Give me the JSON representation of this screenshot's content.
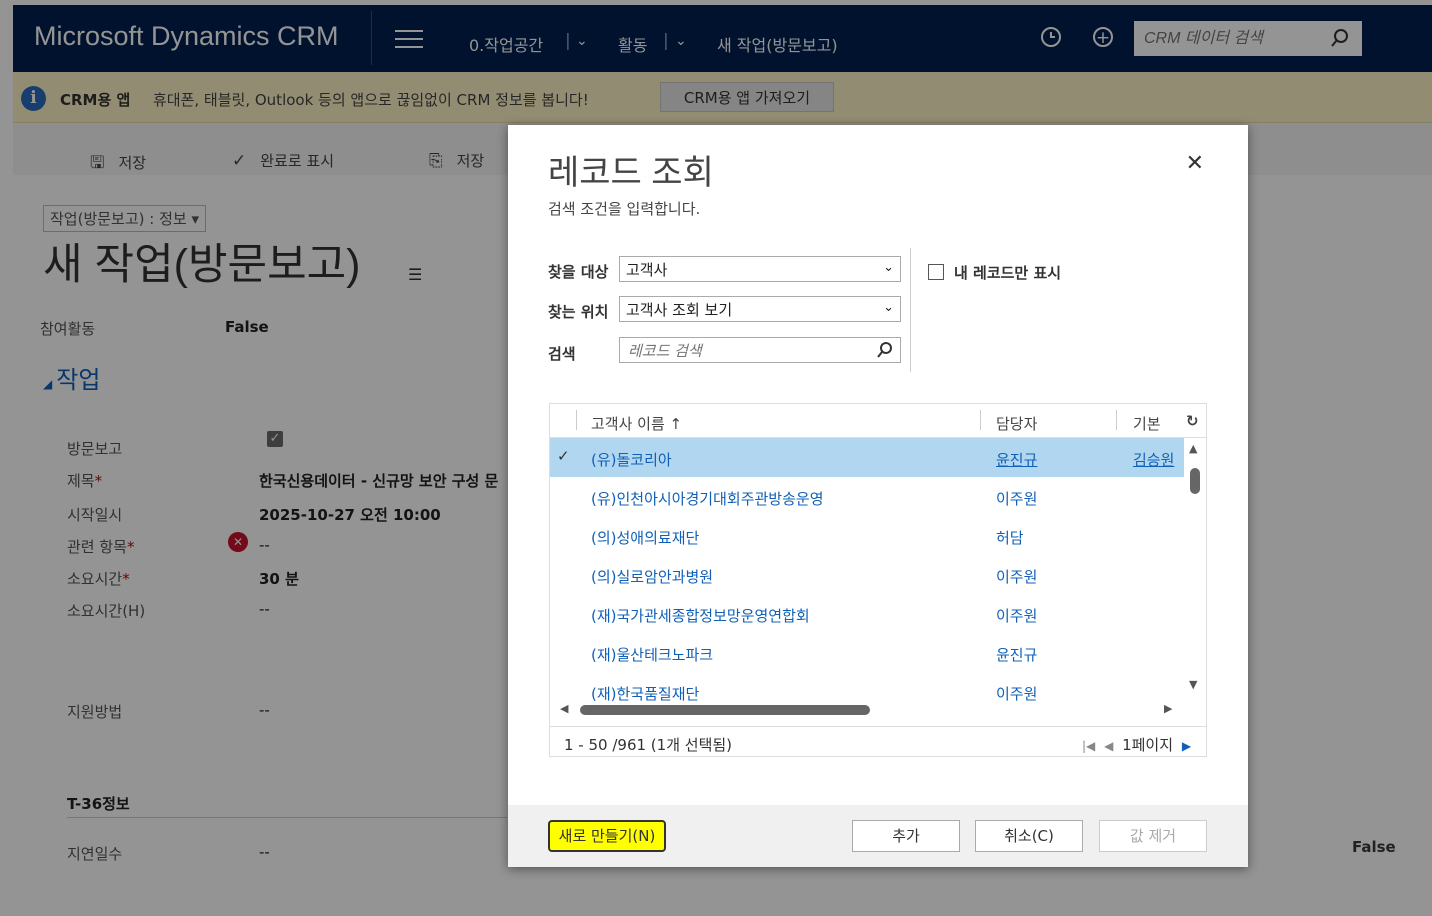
{
  "app": {
    "brand": "Microsoft Dynamics CRM"
  },
  "nav": {
    "workspace": "0.작업공간",
    "activity": "활동",
    "record": "새 작업(방문보고)",
    "search_placeholder": "CRM 데이터 검색"
  },
  "infobar": {
    "title": "CRM용 앱",
    "text": "휴대폰, 태블릿, Outlook 등의 앱으로 끊임없이 CRM 정보를 봅니다!",
    "button": "CRM용 앱 가져오기"
  },
  "commands": {
    "save": "저장",
    "mark_complete": "완료로 표시",
    "save_as": "저장"
  },
  "form": {
    "selector": "작업(방문보고) : 정보",
    "title": "새 작업(방문보고)",
    "participation_label": "참여활동",
    "participation_value": "False",
    "section": "작업",
    "fields": {
      "visit_report": "방문보고",
      "subject_label": "제목",
      "subject_value": "한국신용데이터 - 신규망 보안 구성 문",
      "start_label": "시작일시",
      "start_value": "2025-10-27  오전 10:00",
      "regarding_label": "관련 항목",
      "regarding_value": "--",
      "duration_label": "소요시간",
      "duration_value": "30 분",
      "duration_h_label": "소요시간(H)",
      "duration_h_value": "--",
      "support_label": "지원방법",
      "support_value": "--"
    },
    "section2": "T-36정보",
    "delay_label": "지연일수",
    "delay_value": "--",
    "right_false": "False"
  },
  "dialog": {
    "title": "레코드 조회",
    "subtitle": "검색 조건을 입력합니다.",
    "look_for_label": "찾을 대상",
    "look_for_value": "고객사",
    "look_in_label": "찾는 위치",
    "look_in_value": "고객사 조회 보기",
    "search_label": "검색",
    "search_placeholder": "레코드 검색",
    "mine_only": "내 레코드만 표시",
    "grid": {
      "columns": {
        "name": "고객사 이름 ↑",
        "owner": "담당자",
        "primary": "기본"
      },
      "rows": [
        {
          "name": "(유)돌코리아",
          "owner": "윤진규",
          "primary": "김승원",
          "selected": true
        },
        {
          "name": "(유)인천아시아경기대회주관방송운영",
          "owner": "이주원",
          "primary": ""
        },
        {
          "name": "(의)성애의료재단",
          "owner": "허담",
          "primary": ""
        },
        {
          "name": "(의)실로암안과병원",
          "owner": "이주원",
          "primary": ""
        },
        {
          "name": "(재)국가관세종합정보망운영연합회",
          "owner": "이주원",
          "primary": ""
        },
        {
          "name": "(재)울산테크노파크",
          "owner": "윤진규",
          "primary": ""
        },
        {
          "name": "(재)한국품질재단",
          "owner": "이주원",
          "primary": ""
        }
      ],
      "count": "1 - 50 /961 (1개 선택됨)",
      "page": "1페이지"
    },
    "buttons": {
      "new": "새로 만들기(N)",
      "add": "추가",
      "cancel": "취소(C)",
      "remove": "값 제거"
    }
  }
}
